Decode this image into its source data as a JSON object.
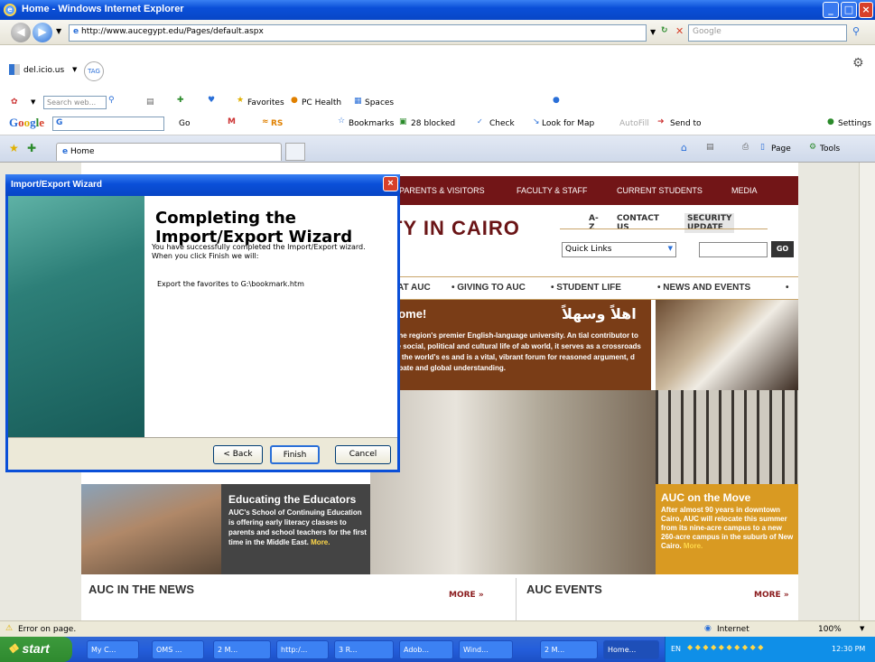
{
  "window": {
    "title": "Home - Windows Internet Explorer"
  },
  "address": {
    "url": "http://www.aucegypt.edu/Pages/default.aspx",
    "search_placeholder": "Google"
  },
  "toolbars": {
    "delicious": "del.icio.us",
    "tag": "TAG",
    "search_web": "Search web...",
    "favorites": "Favorites",
    "pc_health": "PC Health",
    "spaces": "Spaces",
    "google_label": "Google",
    "go": "Go",
    "rs": "RS",
    "bookmarks": "Bookmarks",
    "blocked": "28 blocked",
    "check": "Check",
    "look_for_map": "Look for Map",
    "autofill": "AutoFill",
    "send_to": "Send to",
    "settings": "Settings"
  },
  "tabbar": {
    "tab_label": "Home",
    "page_menu": "Page",
    "tools_menu": "Tools"
  },
  "site": {
    "topnav": [
      "PARENTS & VISITORS",
      "FACULTY & STAFF",
      "CURRENT STUDENTS",
      "MEDIA"
    ],
    "univ_fragment": "TY IN CAIRO",
    "util": {
      "az": "A-Z",
      "contact": "CONTACT US",
      "security": "SECURITY UPDATE"
    },
    "quick_links": "Quick Links",
    "go_btn": "GO",
    "mainnav": [
      "AT AUC",
      "• GIVING TO AUC",
      "• STUDENT LIFE",
      "• NEWS AND EVENTS",
      "•"
    ],
    "welcome": {
      "heading": "come!",
      "arabic": "اهلاً وسهلاً",
      "body": "s the region's premier English-language university. An tial contributor to the social, political and cultural life of ab world, it serves as a crossroads for the world's es and is a vital, vibrant forum for reasoned argument, d debate and global understanding."
    },
    "educators": {
      "heading": "Educating the Educators",
      "body": "AUC's School of Continuing Education is offering early literacy classes to parents and school teachers for the first time in the Middle East.",
      "more": "More."
    },
    "move": {
      "heading": "AUC on the Move",
      "body": "After almost 90 years in downtown Cairo, AUC will relocate this summer from its nine-acre campus to a new 260-acre campus in the suburb of New Cairo.",
      "more": "More."
    },
    "news_heading": "AUC IN THE NEWS",
    "news_more": "MORE »",
    "events_heading": "AUC EVENTS",
    "events_more": "MORE »"
  },
  "dialog": {
    "title": "Import/Export Wizard",
    "heading": "Completing the Import/Export Wizard",
    "intro": "You have successfully completed the Import/Export wizard.  When you click Finish we will:",
    "action": "Export the favorites to G:\\bookmark.htm",
    "back": "< Back",
    "finish": "Finish",
    "cancel": "Cancel"
  },
  "status": {
    "text": "Error on page.",
    "zone": "Internet",
    "zoom": "100%"
  },
  "taskbar": {
    "start": "start",
    "tasks": [
      "My C...",
      "OMS ...",
      "2 M...",
      "http:/...",
      "3 R...",
      "Adob...",
      "Wind...",
      "2 M...",
      "Home..."
    ],
    "lang": "EN",
    "clock": "12:30 PM"
  },
  "colors": {
    "accent": "#0a4fd8",
    "auc_maroon": "#721517",
    "auc_gold": "#d99a22"
  }
}
